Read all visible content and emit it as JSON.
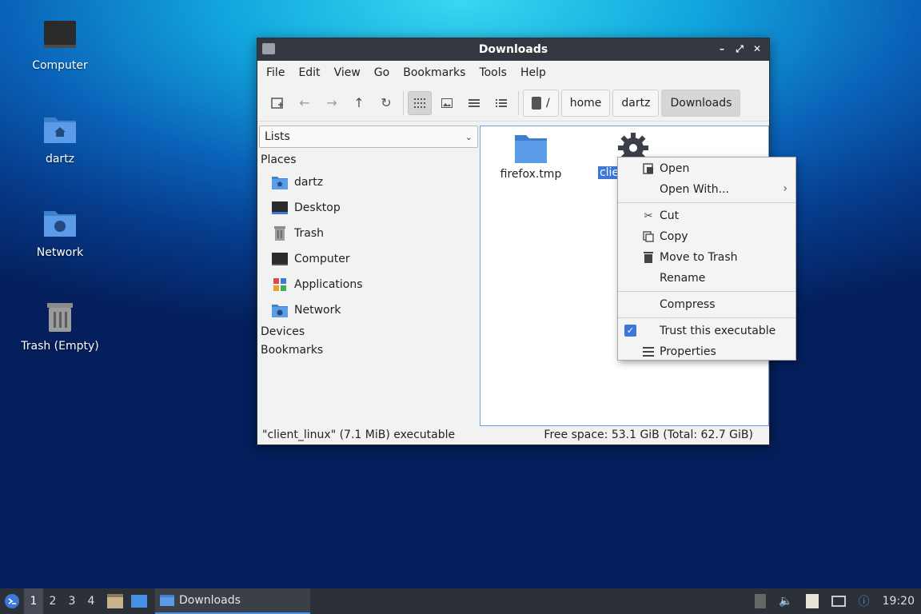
{
  "desktop": {
    "icons": [
      {
        "label": "Computer"
      },
      {
        "label": "dartz"
      },
      {
        "label": "Network"
      },
      {
        "label": "Trash (Empty)"
      }
    ]
  },
  "window": {
    "title": "Downloads",
    "controls": [
      "minimize",
      "maximize",
      "close"
    ],
    "menu": [
      "File",
      "Edit",
      "View",
      "Go",
      "Bookmarks",
      "Tools",
      "Help"
    ],
    "toolbar_icons": [
      "new-tab-icon",
      "back-icon",
      "forward-icon",
      "up-icon",
      "reload-icon",
      "icon-view-icon",
      "thumbnail-view-icon",
      "compact-view-icon",
      "detailed-list-icon"
    ],
    "breadcrumbs": [
      "/",
      "home",
      "dartz",
      "Downloads"
    ],
    "side": {
      "selector": "Lists",
      "places_header": "Places",
      "places": [
        "dartz",
        "Desktop",
        "Trash",
        "Computer",
        "Applications",
        "Network"
      ],
      "devices_header": "Devices",
      "bookmarks_header": "Bookmarks"
    },
    "files": [
      {
        "name": "firefox.tmp"
      },
      {
        "name": "clie"
      }
    ],
    "status": {
      "selection": "\"client_linux\" (7.1 MiB) executable",
      "free_space": "Free space: 53.1 GiB (Total: 62.7 GiB)"
    }
  },
  "context_menu": {
    "items": [
      "Open",
      "Open With...",
      "Cut",
      "Copy",
      "Move to Trash",
      "Rename",
      "Compress",
      "Trust this executable",
      "Properties"
    ],
    "trust_checked": true
  },
  "taskbar": {
    "workspaces": [
      "1",
      "2",
      "3",
      "4"
    ],
    "active_workspace": "1",
    "task_label": "Downloads",
    "clock": "19:20"
  },
  "colors": {
    "accent": "#3d78d8",
    "folder": "#4a8fe0",
    "titlebar": "#33373f",
    "taskbar": "#2c3038"
  }
}
